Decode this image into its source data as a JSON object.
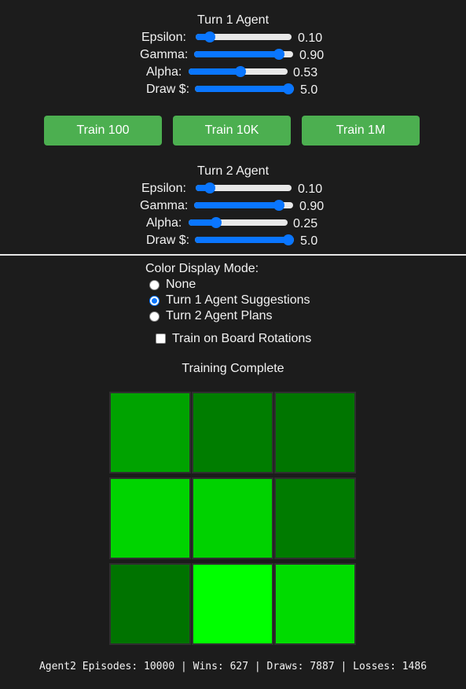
{
  "agent1": {
    "title": "Turn 1 Agent",
    "epsilon": {
      "label": "Epsilon:",
      "value_text": "0.10",
      "level": 0.1
    },
    "gamma": {
      "label": "Gamma:",
      "value_text": "0.90",
      "level": 0.9
    },
    "alpha": {
      "label": "Alpha:",
      "value_text": "0.53",
      "level": 0.53
    },
    "draw": {
      "label": "Draw $:",
      "value_text": "5.0",
      "level": 1.0
    }
  },
  "buttons": {
    "train_100": "Train 100",
    "train_10k": "Train 10K",
    "train_1m": "Train 1M"
  },
  "agent2": {
    "title": "Turn 2 Agent",
    "epsilon": {
      "label": "Epsilon:",
      "value_text": "0.10",
      "level": 0.1
    },
    "gamma": {
      "label": "Gamma:",
      "value_text": "0.90",
      "level": 0.9
    },
    "alpha": {
      "label": "Alpha:",
      "value_text": "0.25",
      "level": 0.25
    },
    "draw": {
      "label": "Draw $:",
      "value_text": "5.0",
      "level": 1.0
    }
  },
  "display_mode": {
    "title": "Color Display Mode:",
    "options": [
      {
        "label": "None",
        "checked": false
      },
      {
        "label": "Turn 1 Agent Suggestions",
        "checked": true
      },
      {
        "label": "Turn 2 Agent Plans",
        "checked": false
      }
    ]
  },
  "rotations": {
    "label": "Train on Board Rotations",
    "checked": false
  },
  "status": "Training Complete",
  "board": {
    "cell_colors": [
      "#00a300",
      "#007d00",
      "#007500",
      "#00d400",
      "#00d200",
      "#007b00",
      "#007300",
      "#00ff00",
      "#00db00"
    ]
  },
  "stats": "Agent2 Episodes: 10000 | Wins: 627 | Draws: 7887 | Losses: 1486",
  "colors": {
    "accent": "#0a76ff",
    "button": "#4caf50",
    "background": "#1c1c1c"
  }
}
